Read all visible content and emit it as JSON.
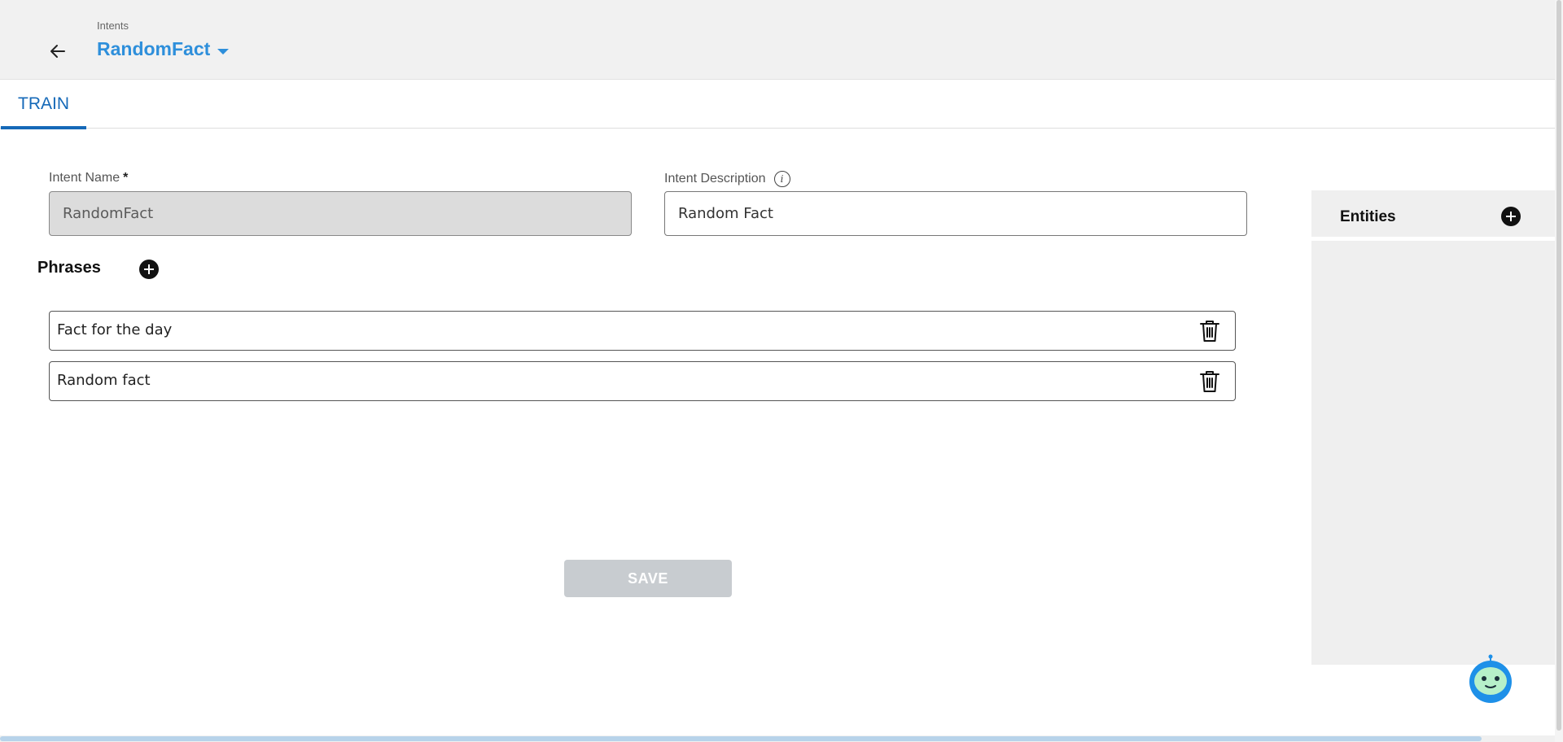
{
  "header": {
    "breadcrumb": "Intents",
    "title": "RandomFact",
    "back_icon": "arrow-left-icon",
    "dropdown_icon": "caret-down-icon"
  },
  "tabs": [
    {
      "label": "TRAIN",
      "active": true
    }
  ],
  "form": {
    "intent_name": {
      "label": "Intent Name",
      "required_mark": "*",
      "value": "RandomFact",
      "disabled": true
    },
    "intent_description": {
      "label": "Intent Description",
      "info_icon": "info-icon",
      "value": "Random Fact"
    }
  },
  "phrases": {
    "title": "Phrases",
    "add_icon": "plus-circle-icon",
    "items": [
      {
        "text": "Fact for the day",
        "delete_icon": "trash-icon"
      },
      {
        "text": "Random fact",
        "delete_icon": "trash-icon"
      }
    ]
  },
  "save_label": "SAVE",
  "entities": {
    "title": "Entities",
    "add_icon": "plus-circle-icon"
  },
  "bot_icon": "robot-assistant-icon",
  "colors": {
    "accent": "#2e8fdb",
    "tab_active": "#1569b8",
    "save_disabled": "#c8ccd0",
    "header_bg": "#f1f1f1",
    "panel_bg": "#efefef"
  }
}
